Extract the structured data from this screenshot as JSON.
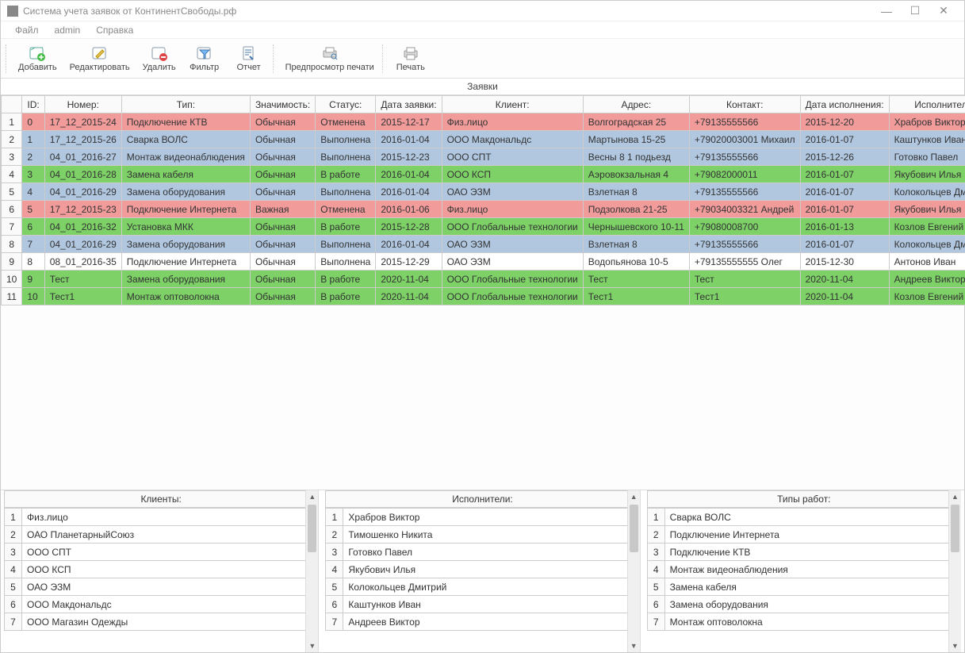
{
  "titlebar": {
    "title": "Система учета заявок от КонтинентСвободы.рф"
  },
  "menubar": {
    "items": [
      "Файл",
      "admin",
      "Справка"
    ]
  },
  "toolbar": {
    "add": "Добавить",
    "edit": "Редактировать",
    "delete": "Удалить",
    "filter": "Фильтр",
    "report": "Отчет",
    "preview": "Предпросмотр печати",
    "print": "Печать"
  },
  "grid": {
    "title": "Заявки",
    "columns": [
      "ID:",
      "Номер:",
      "Тип:",
      "Значимость:",
      "Статус:",
      "Дата заявки:",
      "Клиент:",
      "Адрес:",
      "Контакт:",
      "Дата исполнения:",
      "Исполнитель"
    ],
    "rows": [
      {
        "n": "1",
        "status": "pink",
        "cells": [
          "0",
          "17_12_2015-24",
          "Подключение КТВ",
          "Обычная",
          "Отменена",
          "2015-12-17",
          "Физ.лицо",
          "Волгоградская 25",
          "+79135555566",
          "2015-12-20",
          "Храбров Виктор"
        ]
      },
      {
        "n": "2",
        "status": "blue",
        "cells": [
          "1",
          "17_12_2015-26",
          "Сварка ВОЛС",
          "Обычная",
          "Выполнена",
          "2016-01-04",
          "ООО Макдональдс",
          "Мартынова 15-25",
          "+79020003001 Михаил",
          "2016-01-07",
          "Каштунков Иван"
        ]
      },
      {
        "n": "3",
        "status": "blue",
        "cells": [
          "2",
          "04_01_2016-27",
          "Монтаж видеонаблюдения",
          "Обычная",
          "Выполнена",
          "2015-12-23",
          "ООО СПТ",
          "Весны 8 1 подьезд",
          "+79135555566",
          "2015-12-26",
          "Готовко Павел"
        ]
      },
      {
        "n": "4",
        "status": "green",
        "cells": [
          "3",
          "04_01_2016-28",
          "Замена кабеля",
          "Обычная",
          "В работе",
          "2016-01-04",
          "ООО КСП",
          "Аэровокзальная 4",
          "+79082000011",
          "2016-01-07",
          "Якубович Илья"
        ]
      },
      {
        "n": "5",
        "status": "blue",
        "cells": [
          "4",
          "04_01_2016-29",
          "Замена оборудования",
          "Обычная",
          "Выполнена",
          "2016-01-04",
          "ОАО ЭЗМ",
          "Взлетная 8",
          "+79135555566",
          "2016-01-07",
          "Колокольцев Дмитрий"
        ]
      },
      {
        "n": "6",
        "status": "pink",
        "cells": [
          "5",
          "17_12_2015-23",
          "Подключение Интернета",
          "Важная",
          "Отменена",
          "2016-01-06",
          "Физ.лицо",
          "Подзолкова 21-25",
          "+79034003321 Андрей",
          "2016-01-07",
          "Якубович Илья"
        ]
      },
      {
        "n": "7",
        "status": "green",
        "cells": [
          "6",
          "04_01_2016-32",
          "Установка МКК",
          "Обычная",
          "В работе",
          "2015-12-28",
          "ООО Глобальные технологии",
          "Чернышевского 10-11",
          "+79080008700",
          "2016-01-13",
          "Козлов Евгений"
        ]
      },
      {
        "n": "8",
        "status": "blue",
        "cells": [
          "7",
          "04_01_2016-29",
          "Замена оборудования",
          "Обычная",
          "Выполнена",
          "2016-01-04",
          "ОАО ЭЗМ",
          "Взлетная 8",
          "+79135555566",
          "2016-01-07",
          "Колокольцев Дмитрий"
        ]
      },
      {
        "n": "9",
        "status": "white",
        "cells": [
          "8",
          "08_01_2016-35",
          "Подключение Интернета",
          "Обычная",
          "Выполнена",
          "2015-12-29",
          "ОАО ЭЗМ",
          "Водопьянова 10-5",
          "+79135555555 Олег",
          "2015-12-30",
          "Антонов Иван"
        ]
      },
      {
        "n": "10",
        "status": "green",
        "cells": [
          "9",
          "Тест",
          "Замена оборудования",
          "Обычная",
          "В работе",
          "2020-11-04",
          "ООО Глобальные технологии",
          "Тест",
          "Тест",
          "2020-11-04",
          "Андреев Виктор"
        ]
      },
      {
        "n": "11",
        "status": "green",
        "cells": [
          "10",
          "Тест1",
          "Монтаж оптоволокна",
          "Обычная",
          "В работе",
          "2020-11-04",
          "ООО Глобальные технологии",
          "Тест1",
          "Тест1",
          "2020-11-04",
          "Козлов Евгений"
        ]
      }
    ]
  },
  "panels": {
    "clients": {
      "title": "Клиенты:",
      "items": [
        "Физ.лицо",
        "ОАО ПланетарныйСоюз",
        "ООО СПТ",
        "ООО КСП",
        "ОАО ЭЗМ",
        "ООО Макдональдс",
        "ООО Магазин Одежды"
      ]
    },
    "workers": {
      "title": "Исполнители:",
      "items": [
        "Храбров Виктор",
        "Тимошенко Никита",
        "Готовко Павел",
        "Якубович Илья",
        "Колокольцев Дмитрий",
        "Каштунков Иван",
        "Андреев Виктор"
      ]
    },
    "types": {
      "title": "Типы работ:",
      "items": [
        "Сварка ВОЛС",
        "Подключение Интернета",
        "Подключение КТВ",
        "Монтаж видеонаблюдения",
        "Замена кабеля",
        "Замена оборудования",
        "Монтаж оптоволокна"
      ]
    }
  }
}
